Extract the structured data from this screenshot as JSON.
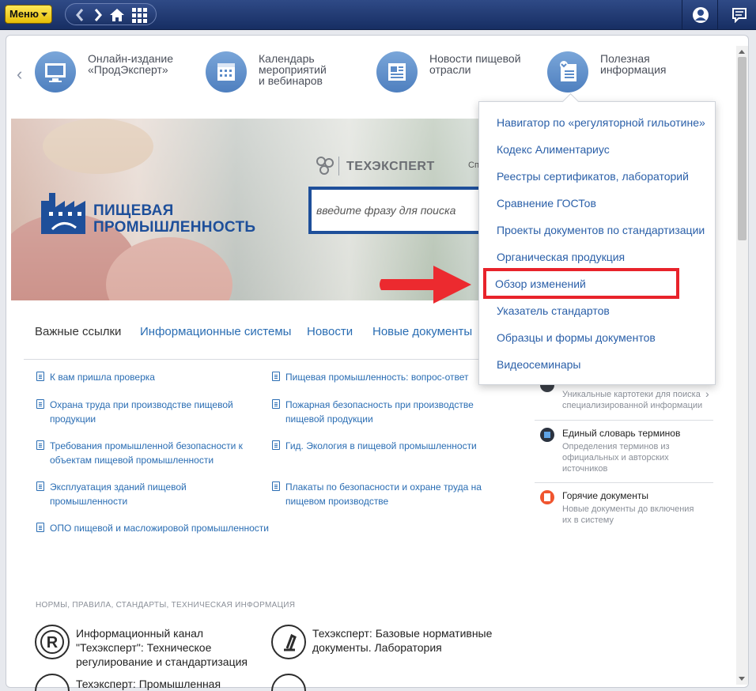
{
  "topbar": {
    "menu_label": "Меню",
    "nav_icons": [
      "back-arrow-icon",
      "forward-arrow-icon",
      "home-icon",
      "grid-icon"
    ],
    "right_icons": [
      "user-icon",
      "chat-icon"
    ]
  },
  "carousel": [
    {
      "label": "Онлайн-издание\n«ПродЭксперт»",
      "icon": "monitor-icon"
    },
    {
      "label": "Календарь\nмероприятий\nи вебинаров",
      "icon": "calendar-icon"
    },
    {
      "label": "Новости пищевой\nотрасли",
      "icon": "newspaper-icon"
    },
    {
      "label": "Полезная\nинформация",
      "icon": "info-doc-icon"
    }
  ],
  "banner": {
    "brand_line1": "ПИЩЕВАЯ",
    "brand_line2": "ПРОМЫШЛЕННОСТЬ",
    "techexpert": "ТЕХЭКСПЕRТ",
    "techexpert_right": "Сп",
    "search_placeholder": "введите фразу для поиска"
  },
  "tabs": [
    "Важные ссылки",
    "Информационные системы",
    "Новости",
    "Новые документы"
  ],
  "links_left": [
    "К вам пришла проверка",
    "Охрана труда при производстве пищевой продукции",
    "Требования промышленной безопасности к объектам пищевой промышленности",
    "Эксплуатация зданий пищевой промышленности",
    "ОПО пищевой и масложировой промышленности"
  ],
  "links_right": [
    "Пищевая промышленность: вопрос-ответ",
    "Пожарная безопасность при производстве пищевой продукции",
    "Гид. Экология в пищевой промышленности",
    "Плакаты по безопасности и охране труда на пищевом производстве"
  ],
  "right_column": [
    {
      "title": "",
      "desc": "Уникальные картотеки для поиска специализированной информации"
    },
    {
      "title": "Единый словарь терминов",
      "desc": "Определения терминов из официальных и авторских источников"
    },
    {
      "title": "Горячие документы",
      "desc": "Новые документы до включения их в систему"
    }
  ],
  "section_head": "НОРМЫ, ПРАВИЛА, СТАНДАРТЫ, ТЕХНИЧЕСКАЯ ИНФОРМАЦИЯ",
  "norms": [
    {
      "text": "Информационный канал \"Техэксперт\": Техническое регулирование и стандартизация"
    },
    {
      "text": "Техэксперт: Базовые нормативные документы. Лаборатория"
    },
    {
      "text": "Техэксперт: Промышленная"
    }
  ],
  "dropdown": [
    "Навигатор по «регуляторной гильотине»",
    "Кодекс Алиментариус",
    "Реестры сертификатов, лабораторий",
    "Сравнение ГОСТов",
    "Проекты документов по стандартизации",
    "Органическая продукция",
    "Обзор изменений",
    "Указатель стандартов",
    "Образцы и формы документов",
    "Видеосеминары"
  ],
  "colors": {
    "topbar": "#1f3873",
    "accent_blue": "#1e4f9a",
    "link": "#2a6db3",
    "highlight_red": "#e8232b",
    "menu_yellow": "#f5d21e"
  }
}
